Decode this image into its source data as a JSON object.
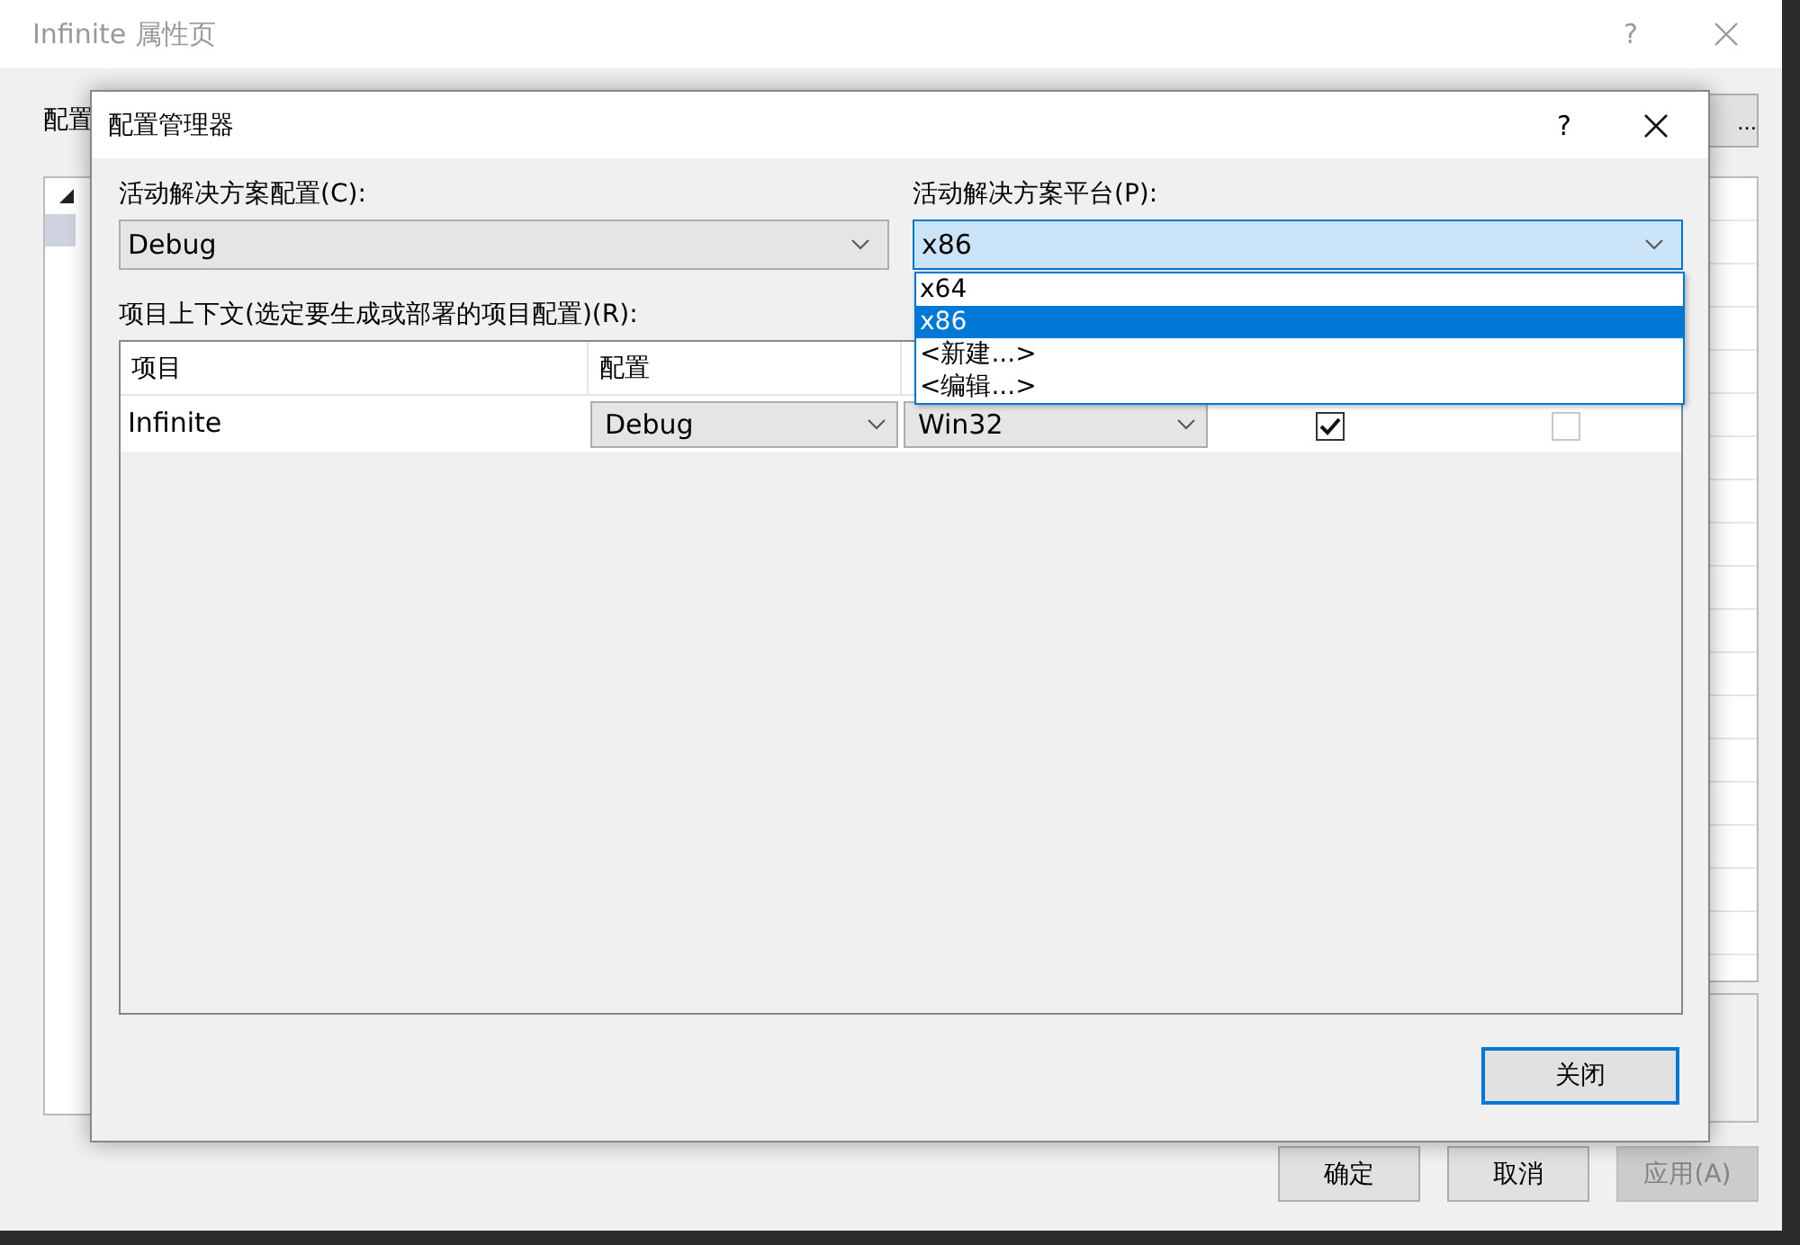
{
  "back_window": {
    "title": "Infinite 属性页",
    "help": "?",
    "config_label": "配置",
    "more_button": "...",
    "buttons": [
      {
        "label": "确定",
        "disabled": false
      },
      {
        "label": "取消",
        "disabled": false
      },
      {
        "label": "应用(A)",
        "disabled": true
      }
    ]
  },
  "dialog": {
    "title": "配置管理器",
    "help": "?",
    "solution_config": {
      "label": "活动解决方案配置(C):",
      "value": "Debug"
    },
    "solution_platform": {
      "label": "活动解决方案平台(P):",
      "value": "x86",
      "expanded": true,
      "options": [
        {
          "label": "x64",
          "selected": false
        },
        {
          "label": "x86",
          "selected": true
        },
        {
          "label": "<新建...>",
          "selected": false
        },
        {
          "label": "<编辑...>",
          "selected": false
        }
      ]
    },
    "project_context": {
      "label": "项目上下文(选定要生成或部署的项目配置)(R):",
      "columns": [
        "项目",
        "配置"
      ],
      "rows": [
        {
          "project": "Infinite",
          "configuration": "Debug",
          "platform": "Win32",
          "build": {
            "checked": true,
            "disabled": false
          },
          "deploy": {
            "checked": false,
            "disabled": true
          }
        }
      ]
    },
    "close_button": "关闭"
  }
}
